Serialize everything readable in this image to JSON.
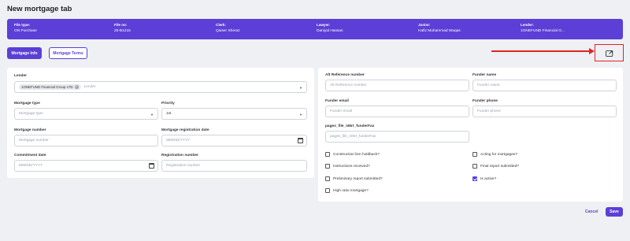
{
  "page": {
    "title": "New mortgage tab"
  },
  "banner": [
    {
      "label": "File type:",
      "value": "ON Purchase"
    },
    {
      "label": "File no:",
      "value": "25-B1215"
    },
    {
      "label": "Clerk:",
      "value": "Qaiser Sheraz"
    },
    {
      "label": "Lawyer:",
      "value": "Daniyal Hassan"
    },
    {
      "label": "Junior:",
      "value": "Hafiz Muhammad Waqas"
    },
    {
      "label": "Lender:",
      "value": "1ONEFUND Financial G..."
    }
  ],
  "tabs": {
    "info": "Mortgage Info",
    "terms": "Mortgage Terms"
  },
  "left": {
    "lender": {
      "label": "Lender",
      "chip": "1ONEFUND Financial Group LTD",
      "placeholder": "Lender"
    },
    "mortgage_type": {
      "label": "Mortgage type",
      "placeholder": "Mortgage type"
    },
    "priority": {
      "label": "Priority",
      "value": "1st"
    },
    "mortgage_number": {
      "label": "Mortgage number",
      "placeholder": "Mortgage number"
    },
    "registration_date": {
      "label": "Mortgage registration date",
      "placeholder": "MM/DD/YYYY"
    },
    "commitment_date": {
      "label": "Commitment date",
      "placeholder": "MM/DD/YYYY"
    },
    "registration_number": {
      "label": "Registration number",
      "placeholder": "Registration number"
    }
  },
  "right": {
    "alt_ref": {
      "label": "Alt Reference number",
      "placeholder": "Alt Reference number"
    },
    "funder_name": {
      "label": "Funder name",
      "placeholder": "Funder name"
    },
    "funder_email": {
      "label": "Funder email",
      "placeholder": "Funder email"
    },
    "funder_phone": {
      "label": "Funder phone",
      "placeholder": "Funder phone"
    },
    "funder_fax": {
      "label": "pages_file_nMrt_funderFax",
      "placeholder": "pages_file_nMrt_funderFax"
    },
    "checkboxes": {
      "construction": {
        "label": "Construction lien holdback?",
        "checked": false
      },
      "acting": {
        "label": "Acting for mortgagee?",
        "checked": false
      },
      "instructions": {
        "label": "Instructions received?",
        "checked": false
      },
      "final_report": {
        "label": "Final report submitted?",
        "checked": false
      },
      "preliminary": {
        "label": "Preliminary report submitted?",
        "checked": false
      },
      "is_active": {
        "label": "Is active?",
        "checked": true
      },
      "high_ratio": {
        "label": "High ratio mortgage?",
        "checked": false
      }
    }
  },
  "actions": {
    "cancel": "Cancel",
    "save": "Save"
  },
  "icons": {
    "export": "export-icon",
    "dropdown": "chevron-down-icon",
    "calendar": "calendar-icon"
  },
  "colors": {
    "accent": "#5b3fd6",
    "highlight": "#e02424"
  }
}
